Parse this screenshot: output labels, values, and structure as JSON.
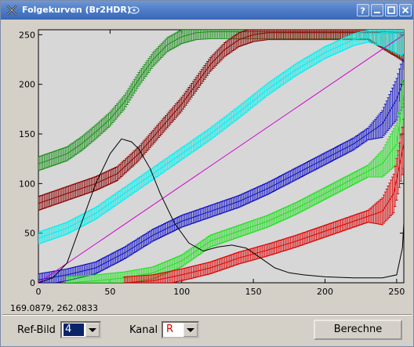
{
  "window": {
    "title": "Folgekurven (Br2HDR)"
  },
  "titlebar_buttons": [
    {
      "name": "help-button",
      "icon": "question-icon"
    },
    {
      "name": "minimize-button",
      "icon": "minimize-icon"
    },
    {
      "name": "maximize-button",
      "icon": "maximize-icon"
    },
    {
      "name": "close-button",
      "icon": "close-icon"
    }
  ],
  "colors": {
    "background": "#d4d0c8",
    "plot_bg": "#d7d7d7",
    "dark_green": "#1a8f1a",
    "dark_red": "#8b0000",
    "cyan": "#00f0f0",
    "blue": "#1010c8",
    "green": "#22e022",
    "red": "#e00000",
    "magenta": "#d000d0",
    "black": "#000000"
  },
  "status": {
    "coordinates": "169.0879,   262.0833"
  },
  "controls": {
    "ref_label": "Ref-Bild",
    "ref_value": "4",
    "kanal_label": "Kanal",
    "kanal_value": "R",
    "compute_button": "Berechne"
  },
  "chart_data": {
    "type": "line",
    "title": "",
    "xlabel": "",
    "ylabel": "",
    "xlim": [
      0,
      255
    ],
    "ylim": [
      0,
      255
    ],
    "x_ticks": [
      0,
      50,
      100,
      150,
      200,
      250
    ],
    "y_ticks": [
      0,
      50,
      100,
      150,
      200,
      250
    ],
    "grid": false,
    "legend": "none",
    "series": [
      {
        "color_key": "dark_green",
        "error": 7,
        "points": [
          [
            0,
            120
          ],
          [
            10,
            125
          ],
          [
            20,
            130
          ],
          [
            30,
            140
          ],
          [
            40,
            152
          ],
          [
            50,
            165
          ],
          [
            60,
            182
          ],
          [
            70,
            205
          ],
          [
            80,
            225
          ],
          [
            90,
            240
          ],
          [
            100,
            248
          ],
          [
            110,
            252
          ],
          [
            120,
            253
          ],
          [
            255,
            253
          ]
        ]
      },
      {
        "color_key": "dark_red",
        "error": 7,
        "points": [
          [
            0,
            80
          ],
          [
            20,
            90
          ],
          [
            40,
            100
          ],
          [
            55,
            110
          ],
          [
            70,
            130
          ],
          [
            85,
            155
          ],
          [
            100,
            180
          ],
          [
            110,
            200
          ],
          [
            120,
            220
          ],
          [
            130,
            235
          ],
          [
            140,
            245
          ],
          [
            150,
            250
          ],
          [
            160,
            252
          ],
          [
            255,
            252
          ]
        ]
      },
      {
        "color_key": "cyan",
        "error": 6,
        "points": [
          [
            0,
            45
          ],
          [
            20,
            55
          ],
          [
            40,
            70
          ],
          [
            60,
            90
          ],
          [
            80,
            110
          ],
          [
            100,
            130
          ],
          [
            120,
            150
          ],
          [
            140,
            172
          ],
          [
            160,
            195
          ],
          [
            180,
            215
          ],
          [
            200,
            232
          ],
          [
            220,
            245
          ],
          [
            240,
            252
          ],
          [
            255,
            253
          ]
        ]
      },
      {
        "color_key": "blue",
        "error": 6,
        "points": [
          [
            0,
            3
          ],
          [
            20,
            8
          ],
          [
            40,
            15
          ],
          [
            60,
            30
          ],
          [
            80,
            48
          ],
          [
            100,
            62
          ],
          [
            120,
            72
          ],
          [
            140,
            82
          ],
          [
            160,
            95
          ],
          [
            180,
            110
          ],
          [
            200,
            125
          ],
          [
            220,
            140
          ],
          [
            240,
            160
          ],
          [
            250,
            185
          ],
          [
            255,
            205
          ]
        ]
      },
      {
        "color_key": "green",
        "error": 6,
        "points": [
          [
            20,
            0
          ],
          [
            40,
            2
          ],
          [
            60,
            5
          ],
          [
            80,
            10
          ],
          [
            100,
            22
          ],
          [
            120,
            42
          ],
          [
            140,
            52
          ],
          [
            160,
            62
          ],
          [
            180,
            75
          ],
          [
            200,
            90
          ],
          [
            220,
            105
          ],
          [
            240,
            120
          ],
          [
            250,
            140
          ],
          [
            255,
            190
          ]
        ]
      },
      {
        "color_key": "red",
        "error": 6,
        "points": [
          [
            60,
            0
          ],
          [
            80,
            2
          ],
          [
            100,
            8
          ],
          [
            120,
            15
          ],
          [
            140,
            25
          ],
          [
            160,
            33
          ],
          [
            180,
            42
          ],
          [
            200,
            52
          ],
          [
            220,
            62
          ],
          [
            240,
            72
          ],
          [
            248,
            90
          ],
          [
            255,
            140
          ]
        ]
      },
      {
        "color_key": "magenta",
        "error": 0,
        "points": [
          [
            0,
            0
          ],
          [
            255,
            250
          ]
        ]
      },
      {
        "color_key": "black",
        "error": 0,
        "points": [
          [
            0,
            0
          ],
          [
            10,
            5
          ],
          [
            20,
            20
          ],
          [
            30,
            60
          ],
          [
            40,
            100
          ],
          [
            50,
            130
          ],
          [
            58,
            145
          ],
          [
            65,
            142
          ],
          [
            70,
            135
          ],
          [
            78,
            115
          ],
          [
            85,
            90
          ],
          [
            95,
            60
          ],
          [
            105,
            40
          ],
          [
            115,
            32
          ],
          [
            125,
            36
          ],
          [
            135,
            38
          ],
          [
            145,
            35
          ],
          [
            155,
            25
          ],
          [
            165,
            15
          ],
          [
            175,
            10
          ],
          [
            185,
            8
          ],
          [
            200,
            6
          ],
          [
            220,
            5
          ],
          [
            240,
            5
          ],
          [
            250,
            8
          ],
          [
            254,
            35
          ],
          [
            255,
            60
          ]
        ]
      }
    ]
  }
}
